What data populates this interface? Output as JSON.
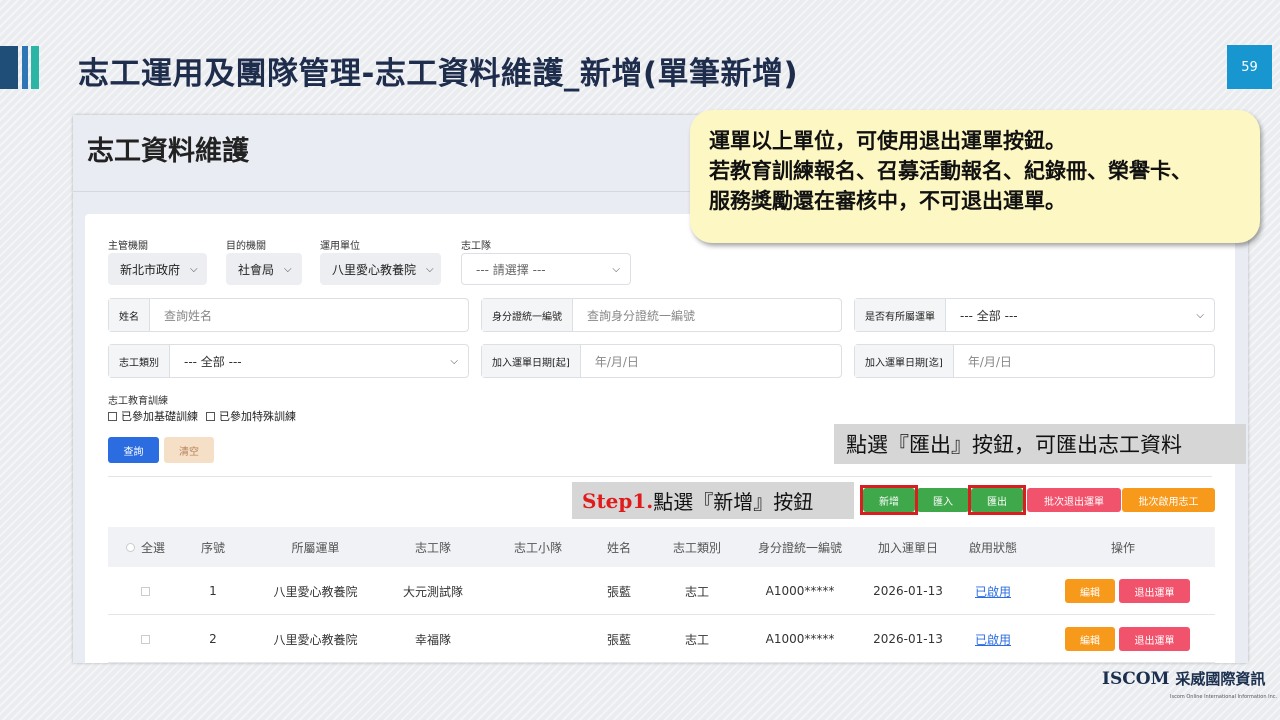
{
  "slide": {
    "title": "志工運用及團隊管理-志工資料維護_新增(單筆新增)",
    "page_number": "59"
  },
  "screen": {
    "title": "志工資料維護"
  },
  "filters": {
    "agency_label": "主管機關",
    "agency_value": "新北市政府",
    "dept_label": "目的機關",
    "dept_value": "社會局",
    "unit_label": "運用單位",
    "unit_value": "八里愛心教養院",
    "team_label": "志工隊",
    "team_placeholder": "--- 請選擇 ---",
    "name_label": "姓名",
    "name_placeholder": "查詢姓名",
    "id_label": "身分證統一編號",
    "id_placeholder": "查詢身分證統一編號",
    "has_unit_label": "是否有所屬運單",
    "has_unit_value": "--- 全部 ---",
    "type_label": "志工類別",
    "type_value": "--- 全部 ---",
    "join_start_label": "加入運單日期[起]",
    "join_start_placeholder": "年/月/日",
    "join_end_label": "加入運單日期[迄]",
    "join_end_placeholder": "年/月/日",
    "training_label": "志工教育訓練",
    "training_basic": "已參加基礎訓練",
    "training_special": "已參加特殊訓練"
  },
  "buttons": {
    "query": "查詢",
    "clear": "清空",
    "add": "新增",
    "import": "匯入",
    "export": "匯出",
    "batch_exit": "批次退出運單",
    "batch_enable": "批次啟用志工"
  },
  "table": {
    "headers": [
      "全選",
      "序號",
      "所屬運單",
      "志工隊",
      "志工小隊",
      "姓名",
      "志工類別",
      "身分證統一編號",
      "加入運單日",
      "啟用狀態",
      "操作"
    ],
    "rows": [
      {
        "no": "1",
        "unit": "八里愛心教養院",
        "team": "大元測試隊",
        "squad": "",
        "name": "張藍",
        "type": "志工",
        "id": "A1000*****",
        "join": "2026-01-13",
        "status": "已啟用",
        "edit": "編輯",
        "exit": "退出運單"
      },
      {
        "no": "2",
        "unit": "八里愛心教養院",
        "team": "幸福隊",
        "squad": "",
        "name": "張藍",
        "type": "志工",
        "id": "A1000*****",
        "join": "2026-01-13",
        "status": "已啟用",
        "edit": "編輯",
        "exit": "退出運單"
      }
    ]
  },
  "annotations": {
    "callout_line1": "運單以上單位，可使用退出運單按鈕。",
    "callout_line2": "若教育訓練報名、召募活動報名、紀錄冊、榮譽卡、",
    "callout_line3": "服務獎勵還在審核中，不可退出運單。",
    "export_note": "點選『匯出』按鈕，可匯出志工資料",
    "step_prefix": "Step1.",
    "step_text": "點選『新增』按鈕"
  },
  "logo": {
    "brand": "ISCOM",
    "chinese": "采威國際資訊",
    "sub": "Iscom Online International Information Inc."
  },
  "colors": {
    "title": "#1f2d4d",
    "primary_blue": "#2b6de0",
    "green": "#3fa84b",
    "pink": "#f2536c",
    "orange": "#f79a1b",
    "highlight_red": "#d71f1f",
    "callout_bg": "#fdf7c4"
  }
}
